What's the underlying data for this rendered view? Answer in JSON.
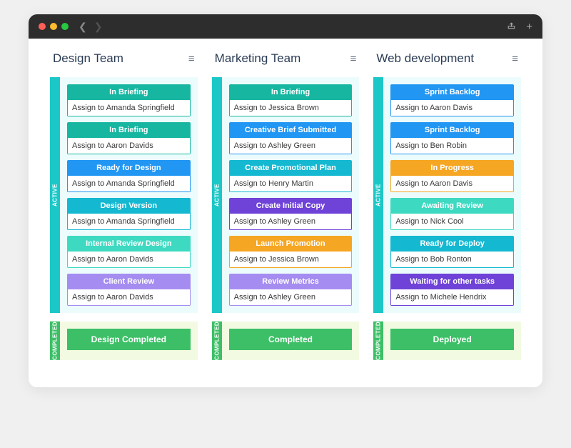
{
  "colors": {
    "teal": "#17b6a0",
    "blue": "#2196f3",
    "cyan": "#14b8d1",
    "mint": "#3ed9c1",
    "lilac": "#a58cf0",
    "purple": "#6f42d8",
    "orange": "#f5a623"
  },
  "sections": {
    "active": "ACTIVE",
    "completed": "COMPLETED"
  },
  "columns": [
    {
      "title": "Design Team",
      "cards": [
        {
          "title": "In Briefing",
          "assignee": "Assign to Amanda Springfield",
          "color": "teal"
        },
        {
          "title": "In Briefing",
          "assignee": "Assign to Aaron Davids",
          "color": "teal"
        },
        {
          "title": "Ready for Design",
          "assignee": "Assign to Amanda Springfield",
          "color": "blue"
        },
        {
          "title": "Design Version",
          "assignee": "Assign to Amanda Springfield",
          "color": "cyan"
        },
        {
          "title": "Internal Review Design",
          "assignee": "Assign to Aaron Davids",
          "color": "mint"
        },
        {
          "title": "Client Review",
          "assignee": "Assign to Aaron Davids",
          "color": "lilac"
        }
      ],
      "completed": "Design Completed"
    },
    {
      "title": "Marketing Team",
      "cards": [
        {
          "title": "In Briefing",
          "assignee": "Assign to Jessica Brown",
          "color": "teal"
        },
        {
          "title": "Creative Brief Submitted",
          "assignee": "Assign to Ashley Green",
          "color": "blue"
        },
        {
          "title": "Create Promotional Plan",
          "assignee": "Assign to Henry Martin",
          "color": "cyan"
        },
        {
          "title": "Create Initial Copy",
          "assignee": "Assign to Ashley Green",
          "color": "purple"
        },
        {
          "title": "Launch Promotion",
          "assignee": "Assign to Jessica Brown",
          "color": "orange"
        },
        {
          "title": "Review Metrics",
          "assignee": "Assign to Ashley Green",
          "color": "lilac"
        }
      ],
      "completed": "Completed"
    },
    {
      "title": "Web development",
      "cards": [
        {
          "title": "Sprint Backlog",
          "assignee": "Assign to Aaron Davis",
          "color": "blue"
        },
        {
          "title": "Sprint Backlog",
          "assignee": "Assign to Ben Robin",
          "color": "blue"
        },
        {
          "title": "In Progress",
          "assignee": "Assign to Aaron Davis",
          "color": "orange"
        },
        {
          "title": "Awaiting Review",
          "assignee": "Assign to Nick Cool",
          "color": "mint"
        },
        {
          "title": "Ready for Deploy",
          "assignee": "Assign to Bob Ronton",
          "color": "cyan"
        },
        {
          "title": "Waiting for other tasks",
          "assignee": "Assign to Michele Hendrix",
          "color": "purple"
        }
      ],
      "completed": "Deployed"
    }
  ]
}
